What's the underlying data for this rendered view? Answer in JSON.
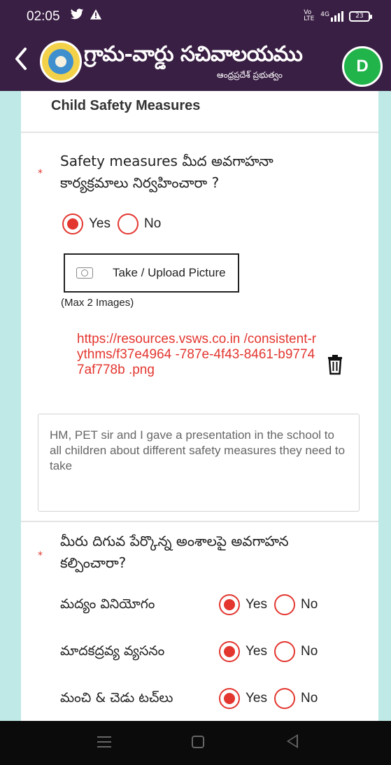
{
  "status_bar": {
    "time": "02:05",
    "icons": [
      "twitter-icon",
      "warning-icon"
    ],
    "network_volte": "Vo LTE",
    "network_signal": "4G",
    "battery": "23"
  },
  "header": {
    "title": "గ్రామ-వార్డు సచివాలయము",
    "subtitle": "ఆంధ్రప్రదేశ్ ప్రభుత్వం",
    "avatar_initial": "D",
    "colors": {
      "header_bg": "#3a1f44",
      "avatar": "#21b44a",
      "accent": "#e3362f"
    }
  },
  "section": {
    "title": "Child Safety Measures"
  },
  "q1": {
    "required_mark": "*",
    "text_line1": "Safety measures మీద అవగాహనా",
    "text_line2": "కార్యక్రమాలు నిర్వహించారా ?",
    "options": {
      "yes": "Yes",
      "no": "No"
    },
    "selected": "Yes",
    "upload_label": "Take / Upload Picture",
    "max_note": "(Max 2 Images)",
    "uploaded_link": "https://resources.vsws.co.in /consistent-rythms/f37e4964 -787e-4f43-8461-b97747af778b .png",
    "comment": "HM, PET sir and I gave a presentation in the school to all children about different safety measures they need to take"
  },
  "q2": {
    "required_mark": "*",
    "text_line1": "మీరు దిగువ పేర్కొన్న అంశాలపై అవగాహన",
    "text_line2": "కల్పించారా?",
    "rows": [
      {
        "label": "మద్యం వినియోగం",
        "yes": "Yes",
        "no": "No",
        "selected": "Yes"
      },
      {
        "label": "మాదకద్రవ్య వ్యసనం",
        "yes": "Yes",
        "no": "No",
        "selected": "Yes"
      },
      {
        "label": "మంచి & చెడు టచ్‌లు",
        "yes": "Yes",
        "no": "No",
        "selected": "Yes"
      }
    ]
  },
  "nav_bar": {
    "icons": [
      "menu-icon",
      "home-icon",
      "back-icon"
    ]
  }
}
